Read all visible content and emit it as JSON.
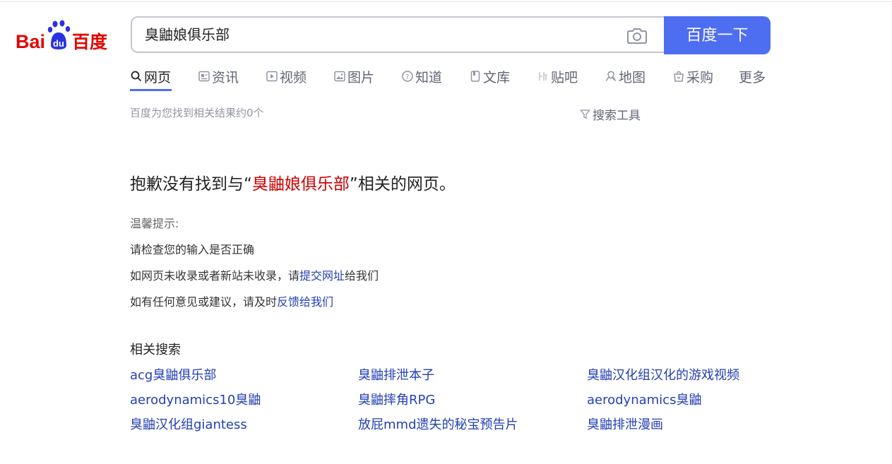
{
  "header": {
    "logo_text": "Baidu百度",
    "search": {
      "query": "臭鼬娘俱乐部",
      "button_label": "百度一下"
    }
  },
  "tabs": [
    {
      "label": "网页",
      "icon": "search-icon",
      "active": true
    },
    {
      "label": "资讯",
      "icon": "news-icon"
    },
    {
      "label": "视频",
      "icon": "video-icon"
    },
    {
      "label": "图片",
      "icon": "image-icon"
    },
    {
      "label": "知道",
      "icon": "question-icon"
    },
    {
      "label": "文库",
      "icon": "document-icon"
    },
    {
      "label": "贴吧",
      "icon": "tieba-icon"
    },
    {
      "label": "地图",
      "icon": "map-icon"
    },
    {
      "label": "采购",
      "icon": "shopping-icon"
    },
    {
      "label": "更多"
    }
  ],
  "result_count": "百度为您找到相关结果约0个",
  "search_tools_label": "搜索工具",
  "no_result": {
    "prefix": "抱歉没有找到与",
    "open_quote": "“",
    "keyword": "臭鼬娘俱乐部",
    "close_quote": "”",
    "suffix": "相关的网页。"
  },
  "tips": {
    "title": "温馨提示:",
    "line1": "请检查您的输入是否正确",
    "line2_prefix": "如网页未收录或者新站未收录，请",
    "line2_link": "提交网址",
    "line2_suffix": "给我们",
    "line3_prefix": "如有任何意见或建议，请及时",
    "line3_link": "反馈给我们"
  },
  "related": {
    "title": "相关搜索",
    "links": [
      [
        "acg臭鼬俱乐部",
        "臭鼬排泄本子",
        "臭鼬汉化组汉化的游戏视频"
      ],
      [
        "aerodynamics10臭鼬",
        "臭鼬摔角RPG",
        "aerodynamics臭鼬"
      ],
      [
        "臭鼬汉化组giantess",
        "放屁mmd遗失的秘宝预告片",
        "臭鼬排泄漫画"
      ]
    ]
  },
  "colors": {
    "brand_blue": "#4e6ef2",
    "link_blue": "#2440b3",
    "keyword_red": "#cc0000",
    "logo_red": "#e10602",
    "logo_blue": "#2932e1"
  }
}
